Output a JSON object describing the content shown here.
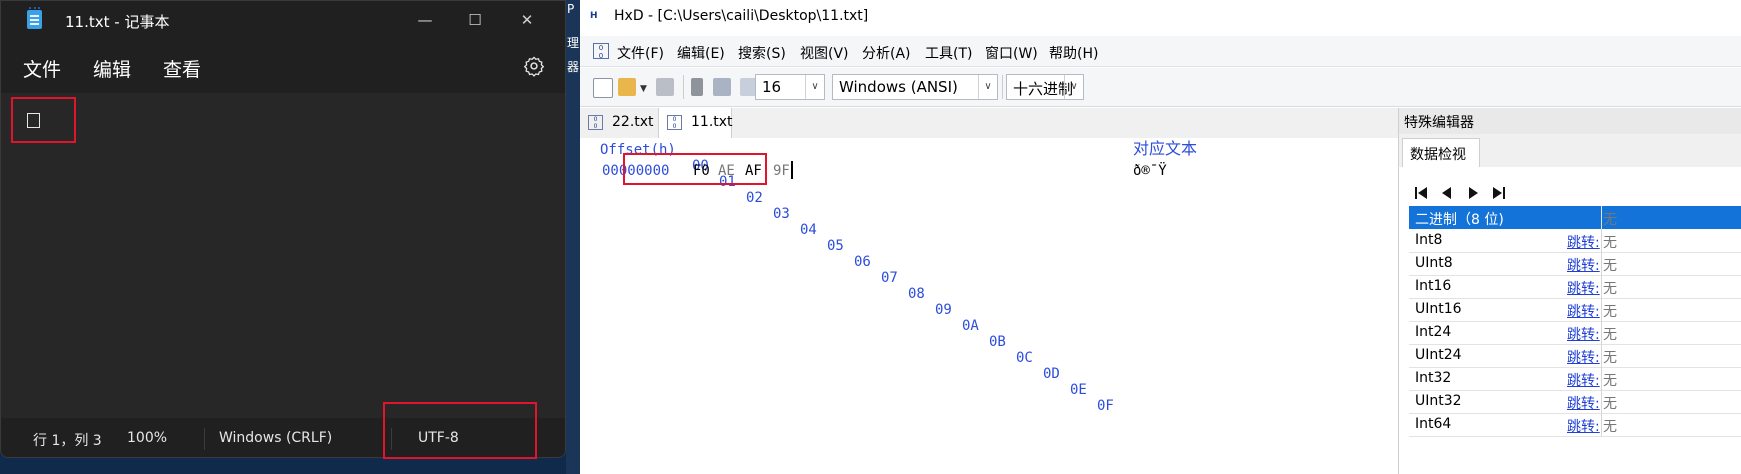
{
  "notepad": {
    "title": "11.txt - 记事本",
    "minimize": "—",
    "maximize": "☐",
    "close": "✕",
    "menu": [
      "文件",
      "编辑",
      "查看"
    ],
    "content": "□",
    "status": {
      "position": "行 1，列 3",
      "zoom": "100%",
      "line_ending": "Windows (CRLF)",
      "encoding": "UTF-8"
    }
  },
  "desktop_strip": [
    "P",
    "理",
    "器"
  ],
  "hxd": {
    "title": "HxD - [C:\\Users\\caili\\Desktop\\11.txt]",
    "menu": [
      "文件(F)",
      "编辑(E)",
      "搜索(S)",
      "视图(V)",
      "分析(A)",
      "工具(T)",
      "窗口(W)",
      "帮助(H)"
    ],
    "toolbar": {
      "bytes_per_row": "16",
      "charset": "Windows (ANSI)",
      "offset_base": "十六进制"
    },
    "tabs": [
      "22.txt",
      "11.txt"
    ],
    "active_tab": "11.txt",
    "offset_header": "Offset(h)",
    "column_headers": [
      "00",
      "01",
      "02",
      "03",
      "04",
      "05",
      "06",
      "07",
      "08",
      "09",
      "0A",
      "0B",
      "0C",
      "0D",
      "0E",
      "0F"
    ],
    "text_header": "对应文本",
    "row_offset": "00000000",
    "bytes": [
      "F0",
      "AE",
      "AF",
      "9F"
    ],
    "decoded_text": "ð®¯Ÿ",
    "side_panel": {
      "title": "特殊编辑器",
      "tab": "数据检视",
      "selected_row": "二进制（8 位)",
      "rows": [
        "Int8",
        "UInt8",
        "Int16",
        "UInt16",
        "Int24",
        "UInt24",
        "Int32",
        "UInt32",
        "Int64"
      ],
      "jump_label": "跳转:",
      "value_text": "无"
    }
  }
}
